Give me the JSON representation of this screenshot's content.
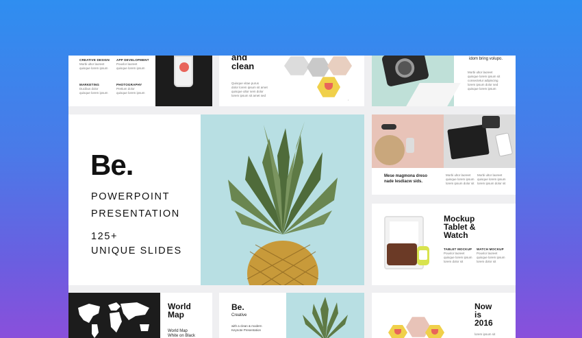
{
  "hero": {
    "logo": "Be.",
    "line1": "POWERPOINT",
    "line2": "PRESENTATION",
    "line3": "125+",
    "line4": "UNIQUE SLIDES"
  },
  "slide_services": {
    "items": [
      {
        "title": "CREATIVE DESIGN",
        "text": [
          "Morbi ultor laoreet",
          "quisque lorem ipsum"
        ]
      },
      {
        "title": "APP DEVELOPMENT",
        "text": [
          "Pouvlor laoreet",
          "quisque lorem ipsum"
        ]
      },
      {
        "title": "MARKETING",
        "text": [
          "Ducibus dolor",
          "quisque lorem ipsum"
        ]
      },
      {
        "title": "PHOTOGRAPHY",
        "text": [
          "Pretium dolor",
          "quisque lorem ipsum"
        ]
      }
    ]
  },
  "slide_clean": {
    "title": "and\nclean",
    "text": [
      "Quisque vitae purus",
      "dolor lorem ipsum sit amet",
      "quisque ultor sem dolor",
      "lorem ipsum sit amet sed"
    ]
  },
  "slide_camera": {
    "title": "idom bring volupo.",
    "text": [
      "Morbi ultor laoreet",
      "quisque lorem ipsum sit",
      "consectetur adipiscing",
      "lorem ipsum dolor sed",
      "quisque lorem ipsum"
    ]
  },
  "slide_flatlay": {
    "title": "Mese magmona dreso\nnade lesdiacw sids.",
    "text": [
      "Morbi ultor laoreet",
      "quisque lorem ipsum",
      "lorem ipsum dolor sit"
    ],
    "text2": [
      "Morbi ultor laoreet",
      "quisque lorem ipsum",
      "lorem ipsum dolor sit"
    ]
  },
  "slide_mockup": {
    "title": "Mockup\nTablet &\nWatch",
    "col1_title": "TABLET MOCKUP",
    "col1_text": [
      "Pouvlor laoreet",
      "quisque lorem ipsum",
      "lorem dolor sit"
    ],
    "col2_title": "WATCH MOCKUP",
    "col2_text": [
      "Pouvlor laoreet",
      "quisque lorem ipsum",
      "lorem dolor sit"
    ]
  },
  "slide_map": {
    "title": "World\nMap",
    "subtitle": "World Map\nWhite on Black"
  },
  "slide_be": {
    "logo": "Be.",
    "tag": "Creative",
    "text": "with a clean & modern\nKeynote Presentation"
  },
  "slide_now": {
    "title": "Now\nis\n2016",
    "text": "lorem ipsum sit"
  },
  "colors": {
    "accent_mint": "#bfe0d8",
    "accent_yellow": "#f0d04a",
    "accent_pink": "#e8c3b8",
    "hero_teal": "#b8dfe3"
  }
}
